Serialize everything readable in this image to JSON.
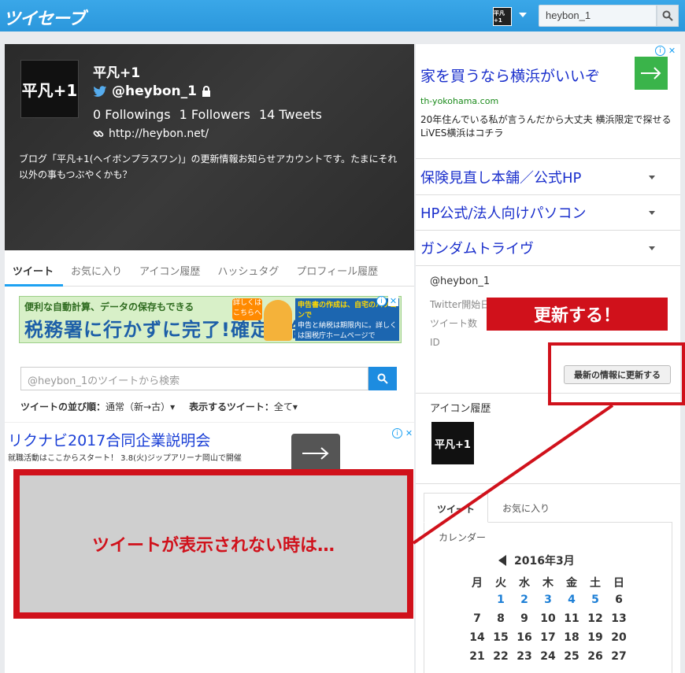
{
  "topbar": {
    "logo": "ツイセーブ",
    "avatar_text": "平凡+1",
    "search_value": "heybon_1"
  },
  "profile": {
    "name": "平凡+1",
    "handle": "@heybon_1",
    "stats": {
      "followings": "0 Followings",
      "followers": "1 Followers",
      "tweets": "14 Tweets"
    },
    "url": "http://heybon.net/",
    "bio": "ブログ「平凡+1(ヘイボンプラスワン)」の更新情報お知らせアカウントです。たまにそれ以外の事もつぶやくかも？",
    "avatar_text": "平凡+1"
  },
  "tabs": [
    "ツイート",
    "お気に入り",
    "アイコン履歴",
    "ハッシュタグ",
    "プロフィール履歴"
  ],
  "tax_ad": {
    "line1": "便利な自動計算、データの保存もできる",
    "line2": "税務署に行かずに完了!確定申告",
    "badge": "詳しくはこちらへ",
    "right_top": "申告書の作成は、自宅のパソコンで",
    "right_bottom": "申告と納税は期限内に。詳しくは国税庁ホームページで"
  },
  "tweet_search": {
    "placeholder": "@heybon_1のツイートから検索"
  },
  "sort": {
    "order_label": "ツイートの並び順：",
    "order_value": "通常（新→古）▾",
    "display_label": "表示するツイート：",
    "display_value": "全て▾"
  },
  "recruit_ad": {
    "title": "リクナビ2017合同企業説明会",
    "sub": "就職活動はここからスタート！ 3.8(火)ジップアリーナ岡山で開催"
  },
  "overlay": {
    "text": "ツイートが表示されない時は…"
  },
  "right": {
    "house_ad": {
      "title": "家を買うなら横浜がいいぞ",
      "url": "th-yokohama.com",
      "desc": "20年住んでいる私が言うんだから大丈夫 横浜限定で探せるLiVES横浜はコチラ"
    },
    "link_ads": [
      "保険見直し本舗／公式HP",
      "HP公式/法人向けパソコン",
      "ガンダムトライヴ"
    ],
    "info": {
      "handle": "@heybon_1",
      "start_label": "Twitter開始日",
      "tweets_label": "ツイート数",
      "id_label": "ID"
    },
    "update_button": "最新の情報に更新する",
    "icon_history_label": "アイコン履歴",
    "icon_history_img": "平凡+1",
    "tabs": [
      "ツイート",
      "お気に入り"
    ],
    "calendar": {
      "label": "カレンダー",
      "month": "2016年3月",
      "weekdays": [
        "月",
        "火",
        "水",
        "木",
        "金",
        "土",
        "日"
      ],
      "rows": [
        [
          "",
          "1",
          "2",
          "3",
          "4",
          "5",
          "6"
        ],
        [
          "7",
          "8",
          "9",
          "10",
          "11",
          "12",
          "13"
        ],
        [
          "14",
          "15",
          "16",
          "17",
          "18",
          "19",
          "20"
        ],
        [
          "21",
          "22",
          "23",
          "24",
          "25",
          "26",
          "27"
        ]
      ],
      "linked_days": [
        "1",
        "2",
        "3",
        "4",
        "5"
      ]
    }
  },
  "annotation": {
    "update_label": "更新する！"
  }
}
